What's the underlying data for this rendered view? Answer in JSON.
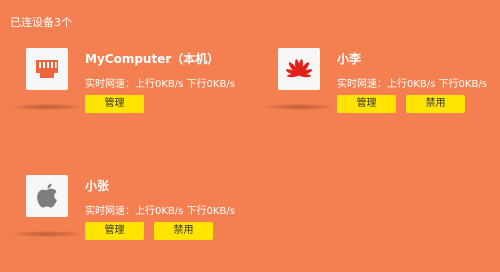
{
  "header": {
    "connected_label": "已连设备3个"
  },
  "devices": [
    {
      "name": "MyComputer（本机）",
      "speed_prefix": "实时网速：",
      "upload": "上行0KB/s",
      "download": "下行0KB/s",
      "manage_label": "管理",
      "icon": "ethernet-port-icon"
    },
    {
      "name": "小李",
      "speed_prefix": "实时网速：",
      "upload": "上行0KB/s",
      "download": "下行0KB/s",
      "manage_label": "管理",
      "block_label": "禁用",
      "icon": "huawei-logo-icon"
    },
    {
      "name": "小张",
      "speed_prefix": "实时网速：",
      "upload": "上行0KB/s",
      "download": "下行0KB/s",
      "manage_label": "管理",
      "block_label": "禁用",
      "icon": "apple-logo-icon"
    }
  ],
  "colors": {
    "background": "#f47f50",
    "button": "#ffe400",
    "icon_accent": "#f0643c",
    "huawei_red": "#e2231a",
    "apple_gray": "#7d7d7d"
  }
}
